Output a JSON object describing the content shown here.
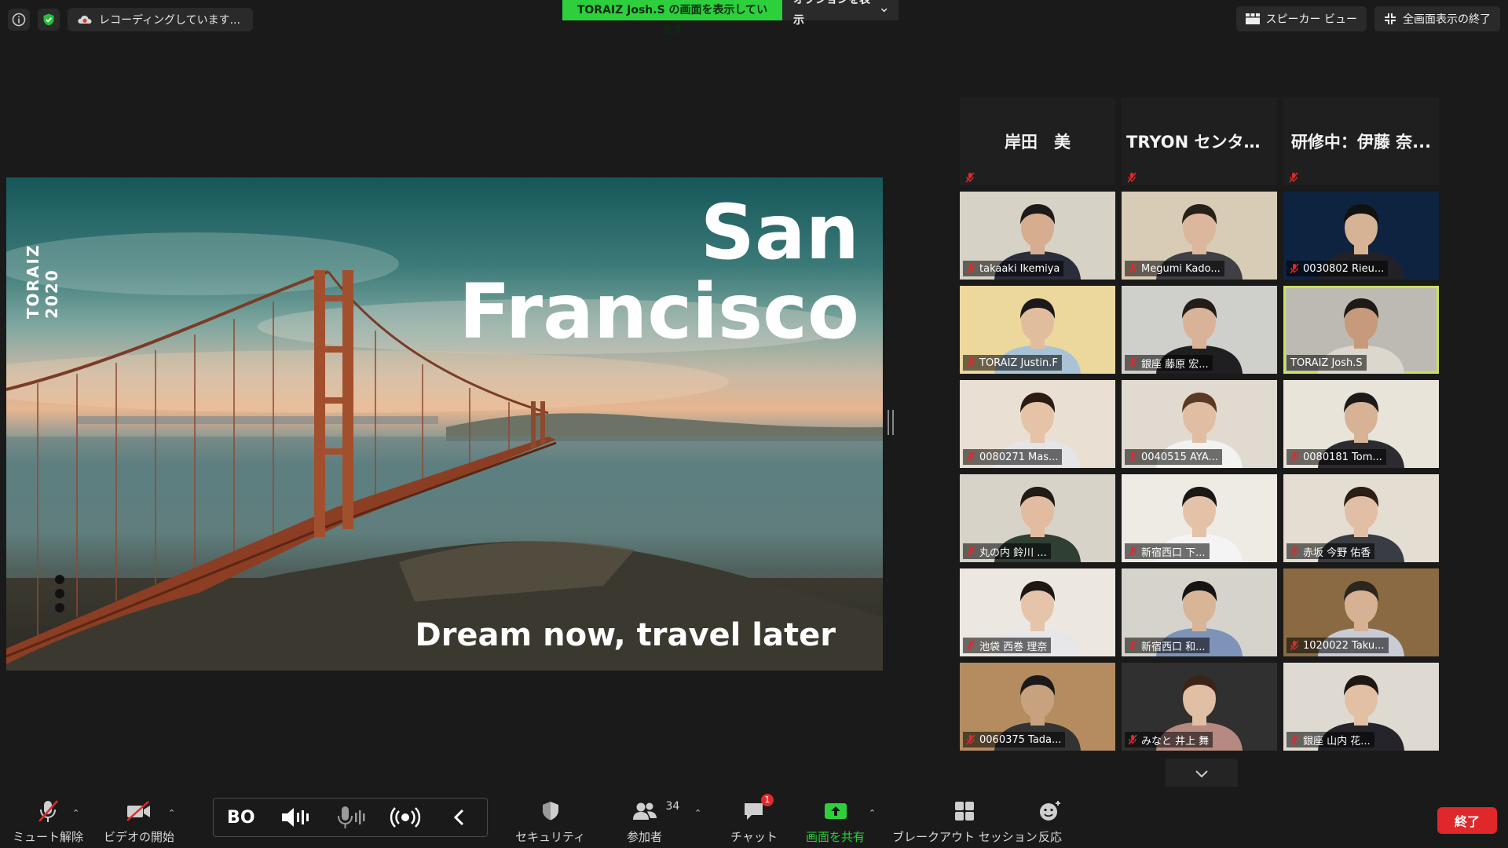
{
  "topbar": {
    "recording_label": "レコーディングしています...",
    "share_banner": "TORAIZ Josh.S の画面を表示しています",
    "options_label": "オプションを表示",
    "speaker_view_label": "スピーカー ビュー",
    "exit_fullscreen_label": "全画面表示の終了"
  },
  "slide": {
    "side_text": "TORAIZ 2020",
    "title_line1": "San",
    "title_line2": "Francisco",
    "tagline": "Dream now, travel later"
  },
  "participants": [
    {
      "name": "岸田　美",
      "type": "name",
      "muted": true
    },
    {
      "name": "TRYON センター...",
      "type": "name",
      "muted": true
    },
    {
      "name": "研修中：伊藤 奈...",
      "type": "name",
      "muted": true
    },
    {
      "name": "takaaki Ikemiya",
      "type": "video",
      "muted": true,
      "bg": "#d7d2c6",
      "shirt": "#2a2e3a",
      "hair": "#1d1b19",
      "skin": "#d6ad8e"
    },
    {
      "name": "Megumi Kado...",
      "type": "video",
      "muted": true,
      "bg": "#d9ccb6",
      "shirt": "#3f3f44",
      "hair": "#262018",
      "skin": "#dcb79e"
    },
    {
      "name": "0030802 Rieu...",
      "type": "video",
      "muted": true,
      "bg": "#0e2340",
      "shirt": "#222226",
      "hair": "#111",
      "skin": "#d7b395"
    },
    {
      "name": "TORAIZ Justin.F",
      "type": "video",
      "muted": true,
      "bg": "#ecd79c",
      "shirt": "#a9c3d6",
      "hair": "#1b1a18",
      "skin": "#e0be9d"
    },
    {
      "name": "銀座 藤原 宏...",
      "type": "video",
      "muted": true,
      "bg": "#cfcfcb",
      "shirt": "#1f1f22",
      "hair": "#231d18",
      "skin": "#d9b398"
    },
    {
      "name": "TORAIZ Josh.S",
      "type": "video",
      "muted": false,
      "active": true,
      "bg": "#bdbab3",
      "shirt": "#dcd7cc",
      "hair": "#1e1a16",
      "skin": "#c69a7a"
    },
    {
      "name": "0080271 Mas...",
      "type": "video",
      "muted": true,
      "bg": "#e9dfd2",
      "shirt": "#e5e5e8",
      "hair": "#2a1c14",
      "skin": "#e6c2a6"
    },
    {
      "name": "0040515 AYA...",
      "type": "video",
      "muted": true,
      "bg": "#e1dad0",
      "shirt": "#f2f2f0",
      "hair": "#5a3a22",
      "skin": "#e0bea4"
    },
    {
      "name": "0080181 Tom...",
      "type": "video",
      "muted": true,
      "bg": "#e8e4da",
      "shirt": "#2c2c30",
      "hair": "#1c1a18",
      "skin": "#d8b294"
    },
    {
      "name": "丸の内 鈴川 ...",
      "type": "video",
      "muted": true,
      "bg": "#d8d3c9",
      "shirt": "#2f3f33",
      "hair": "#221a14",
      "skin": "#e2bca0"
    },
    {
      "name": "新宿西口 下...",
      "type": "video",
      "muted": true,
      "bg": "#eeeae4",
      "shirt": "#f4f4f4",
      "hair": "#1a1816",
      "skin": "#e4c2a8"
    },
    {
      "name": "赤坂 今野 佑香",
      "type": "video",
      "muted": true,
      "bg": "#e3ddd2",
      "shirt": "#3a3c44",
      "hair": "#2b1e14",
      "skin": "#e2bfa4"
    },
    {
      "name": "池袋 西巻 理奈",
      "type": "video",
      "muted": true,
      "bg": "#ece7e0",
      "shirt": "#e7e7ea",
      "hair": "#1e1813",
      "skin": "#e6c4aa"
    },
    {
      "name": "新宿西口 和...",
      "type": "video",
      "muted": true,
      "bg": "#d6d3cd",
      "shirt": "#7e93b8",
      "hair": "#161412",
      "skin": "#d9b597"
    },
    {
      "name": "1020022 Taku...",
      "type": "video",
      "muted": true,
      "bg": "#8a6a42",
      "shirt": "#c9ccd6",
      "hair": "#2c2621",
      "skin": "#d6b194"
    },
    {
      "name": "0060375 Tada...",
      "type": "video",
      "muted": true,
      "bg": "#b48c60",
      "shirt": "#333",
      "hair": "#1b1a18",
      "skin": "#c8a27f"
    },
    {
      "name": "みなと 井上 舞",
      "type": "video",
      "muted": true,
      "bg": "#303030",
      "shirt": "#b68a80",
      "hair": "#3a2418",
      "skin": "#e0bfa5"
    },
    {
      "name": "銀座 山内 花...",
      "type": "video",
      "muted": true,
      "bg": "#dedad2",
      "shirt": "#24242a",
      "hair": "#1e1814",
      "skin": "#e2c0a4"
    }
  ],
  "toolbar": {
    "unmute_label": "ミュート解除",
    "video_label": "ビデオの開始",
    "security_label": "セキュリティ",
    "participants_label": "参加者",
    "participants_count": "34",
    "chat_label": "チャット",
    "chat_badge": "1",
    "share_label": "画面を共有",
    "breakout_label": "ブレークアウト セッション",
    "reactions_label": "反応",
    "end_label": "終了",
    "logo_text": "BO"
  },
  "colors": {
    "share_green": "#2ecf3d",
    "active_border": "#c9e35b",
    "end_red": "#e0272a",
    "mute_red": "#e02a2a"
  }
}
